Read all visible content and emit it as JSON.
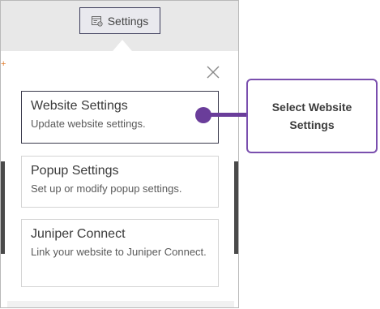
{
  "toolbar": {
    "settings_label": "Settings",
    "settings_icon": "settings-window-icon"
  },
  "popup": {
    "close_icon": "close-icon",
    "options": [
      {
        "title": "Website Settings",
        "description": "Update website settings."
      },
      {
        "title": "Popup Settings",
        "description": "Set up or modify popup settings."
      },
      {
        "title": "Juniper Connect",
        "description": "Link your website to Juniper Connect."
      }
    ]
  },
  "callout": {
    "text": "Select Website Settings"
  },
  "colors": {
    "accent": "#6a3d9a",
    "callout_border": "#7a4fae"
  }
}
